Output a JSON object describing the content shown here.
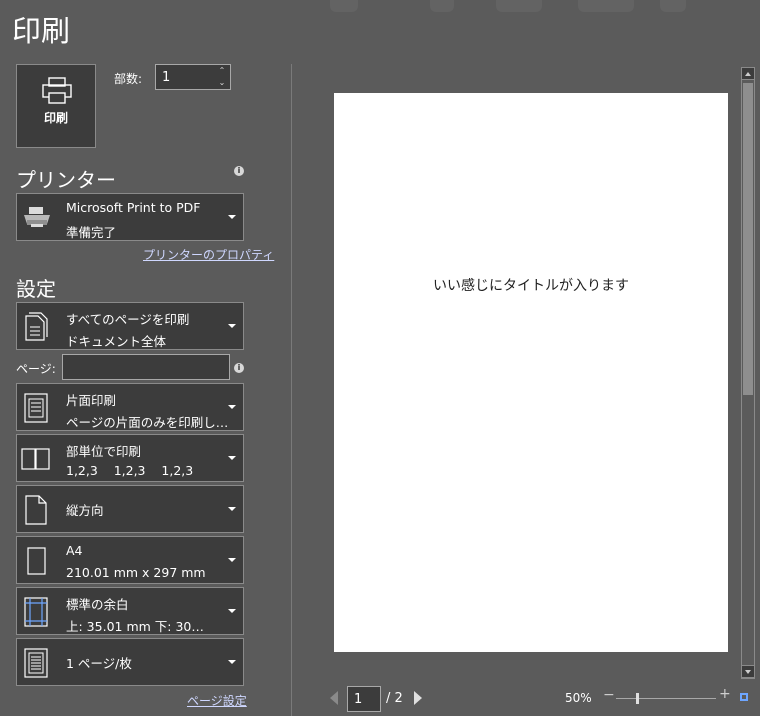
{
  "page": {
    "title": "印刷"
  },
  "print": {
    "label": "印刷"
  },
  "copies": {
    "label": "部数:",
    "value": "1"
  },
  "printer": {
    "heading": "プリンター",
    "name": "Microsoft Print to PDF",
    "status": "準備完了",
    "properties_link": "プリンターのプロパティ"
  },
  "settings": {
    "heading": "設定",
    "scope": {
      "line1": "すべてのページを印刷",
      "line2": "ドキュメント全体"
    },
    "pages_label": "ページ:",
    "pages_value": "",
    "sides": {
      "line1": "片面印刷",
      "line2": "ページの片面のみを印刷し…"
    },
    "collate": {
      "line1": "部単位で印刷",
      "line2": "1,2,3    1,2,3    1,2,3"
    },
    "orientation": {
      "line1": "縦方向"
    },
    "paper_size": {
      "line1": "A4",
      "line2": "210.01 mm x 297 mm"
    },
    "margins": {
      "line1": "標準の余白",
      "line2": "上: 35.01 mm 下: 30…"
    },
    "pages_per_sheet": {
      "line1": "1 ページ/枚"
    },
    "page_setup_link": "ページ設定"
  },
  "preview": {
    "doc_title": "いい感じにタイトルが入ります",
    "current_page": "1",
    "total_pages": "/ 2",
    "zoom": "50%"
  },
  "icons": {
    "info": "info-icon",
    "printer": "printer-icon",
    "dropdown": "chevron-down-icon"
  },
  "colors": {
    "background": "#5b5b5b",
    "panel": "#3c3c3c",
    "accent": "#6ea6ff"
  }
}
